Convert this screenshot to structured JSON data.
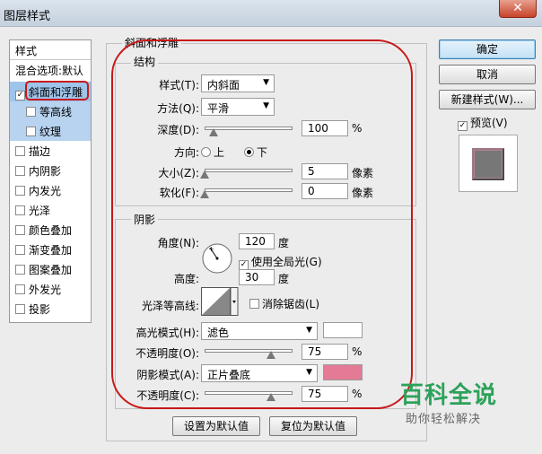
{
  "window": {
    "title": "图层样式",
    "close_glyph": "✕"
  },
  "left_panel": {
    "header": "样式",
    "items": [
      {
        "label": "混合选项:默认",
        "checkbox": false,
        "selected": false
      },
      {
        "label": "斜面和浮雕",
        "checkbox": true,
        "checked": true,
        "selected": true
      },
      {
        "label": "等高线",
        "checkbox": true,
        "checked": false,
        "sub": true
      },
      {
        "label": "纹理",
        "checkbox": true,
        "checked": false,
        "sub": true
      },
      {
        "label": "描边",
        "checkbox": true,
        "checked": false
      },
      {
        "label": "内阴影",
        "checkbox": true,
        "checked": false
      },
      {
        "label": "内发光",
        "checkbox": true,
        "checked": false
      },
      {
        "label": "光泽",
        "checkbox": true,
        "checked": false
      },
      {
        "label": "颜色叠加",
        "checkbox": true,
        "checked": false
      },
      {
        "label": "渐变叠加",
        "checkbox": true,
        "checked": false
      },
      {
        "label": "图案叠加",
        "checkbox": true,
        "checked": false
      },
      {
        "label": "外发光",
        "checkbox": true,
        "checked": false
      },
      {
        "label": "投影",
        "checkbox": true,
        "checked": false
      }
    ]
  },
  "bevel": {
    "section_title": "斜面和浮雕",
    "structure": {
      "title": "结构",
      "style_label": "样式(T):",
      "style_value": "内斜面",
      "technique_label": "方法(Q):",
      "technique_value": "平滑",
      "depth_label": "深度(D):",
      "depth_value": "100",
      "depth_unit": "%",
      "depth_fraction": 0.1,
      "direction_label": "方向:",
      "dir_up": "上",
      "dir_down": "下",
      "direction_selected": "下",
      "size_label": "大小(Z):",
      "size_value": "5",
      "size_unit": "像素",
      "size_fraction": 0.0,
      "soften_label": "软化(F):",
      "soften_value": "0",
      "soften_unit": "像素",
      "soften_fraction": 0.0
    },
    "shading": {
      "title": "阴影",
      "angle_label": "角度(N):",
      "angle_value": "120",
      "angle_unit": "度",
      "global_light_label": "使用全局光(G)",
      "global_light_checked": true,
      "altitude_label": "高度:",
      "altitude_value": "30",
      "altitude_unit": "度",
      "gloss_label": "光泽等高线:",
      "antialias_label": "消除锯齿(L)",
      "antialias_checked": false,
      "highlight_mode_label": "高光模式(H):",
      "highlight_mode_value": "滤色",
      "highlight_color": "#ffffff",
      "highlight_opacity_label": "不透明度(O):",
      "highlight_opacity_value": "75",
      "highlight_opacity_unit": "%",
      "highlight_opacity_fraction": 0.75,
      "shadow_mode_label": "阴影模式(A):",
      "shadow_mode_value": "正片叠底",
      "shadow_color": "#e47a95",
      "shadow_opacity_label": "不透明度(C):",
      "shadow_opacity_value": "75",
      "shadow_opacity_unit": "%",
      "shadow_opacity_fraction": 0.75
    },
    "make_default": "设置为默认值",
    "reset_default": "复位为默认值"
  },
  "right": {
    "ok": "确定",
    "cancel": "取消",
    "new_style": "新建样式(W)...",
    "preview_label": "预览(V)",
    "preview_checked": true
  },
  "watermark": {
    "title": "百科全说",
    "subtitle": "助你轻松解决"
  },
  "colors": {
    "accent_annotation": "#c81818",
    "watermark_green": "#2ca25a"
  }
}
